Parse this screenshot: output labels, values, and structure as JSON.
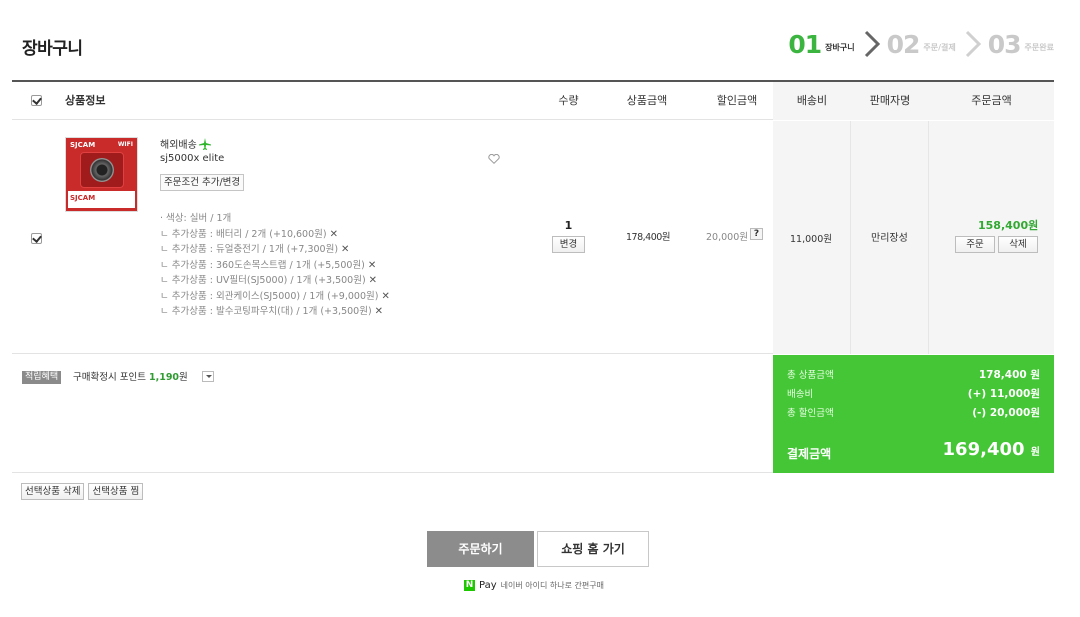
{
  "page": {
    "title": "장바구니"
  },
  "steps": [
    {
      "num": "01",
      "label": "장바구니",
      "active": true
    },
    {
      "num": "02",
      "label": "주문/결제",
      "active": false
    },
    {
      "num": "03",
      "label": "주문완료",
      "active": false
    }
  ],
  "table": {
    "headers": {
      "product_info": "상품정보",
      "quantity": "수량",
      "product_amount": "상품금액",
      "discount_amount": "할인금액",
      "shipping_fee": "배송비",
      "seller": "판매자명",
      "order_amount": "주문금액"
    }
  },
  "item": {
    "checked": true,
    "shipping_type": "해외배송",
    "name": "sj5000x elite",
    "option_button": "주문조건 추가/변경",
    "thumbnail_brand": "SJCAM",
    "thumbnail_wifi": "WIFI",
    "thumbnail_bottom": "SJCAM",
    "options": [
      {
        "text": "· 색상: 실버 / 1개",
        "price": "",
        "removable": false
      },
      {
        "text": "ㄴ 추가상품 : 배터리 / 2개 ",
        "price": "(+10,600원)",
        "removable": true
      },
      {
        "text": "ㄴ 추가상품 : 듀얼충전기 / 1개 ",
        "price": "(+7,300원)",
        "removable": true
      },
      {
        "text": "ㄴ 추가상품 : 360도손목스트랩 / 1개 ",
        "price": "(+5,500원)",
        "removable": true
      },
      {
        "text": "ㄴ 추가상품 : UV필터(SJ5000) / 1개 ",
        "price": "(+3,500원)",
        "removable": true
      },
      {
        "text": "ㄴ 추가상품 : 외관케이스(SJ5000) / 1개 ",
        "price": "(+9,000원)",
        "removable": true
      },
      {
        "text": "ㄴ 추가상품 : 발수코팅파우치(대) / 1개 ",
        "price": "(+3,500원)",
        "removable": true
      }
    ],
    "remove_symbol": "✕",
    "quantity": "1",
    "change_button": "변경",
    "product_amount": "178,400원",
    "discount_amount": "20,000원",
    "discount_help": "?",
    "shipping_fee": "11,000원",
    "seller": "만리장성",
    "order_amount": "158,400원",
    "order_button": "주문",
    "delete_button": "삭제"
  },
  "points": {
    "badge": "적립혜택",
    "text": "구매확정시 포인트",
    "value": "1,190",
    "unit": "원"
  },
  "summary": {
    "total_product_label": "총 상품금액",
    "total_product_value": "178,400 원",
    "shipping_label": "배송비",
    "shipping_value": "(+) 11,000원",
    "discount_label": "총 할인금액",
    "discount_value": "(-) 20,000원",
    "payment_label": "결제금액",
    "payment_value": "169,400",
    "payment_unit": "원"
  },
  "footer": {
    "delete_selected": "선택상품 삭제",
    "wish_selected": "선택상품 찜",
    "order_button": "주문하기",
    "shopping_home": "쇼핑 홈 가기",
    "npay_logo": "N",
    "npay_word": "Pay",
    "npay_text": "네이버 아이디 하나로 간편구매"
  },
  "colors": {
    "accent_green": "#44c636",
    "step_active": "#3bb53f",
    "order_total_green": "#31a932"
  },
  "icons": {
    "airplane": "airplane-icon",
    "heart": "heart-icon",
    "step_chevron": "chevron-right-icon"
  }
}
